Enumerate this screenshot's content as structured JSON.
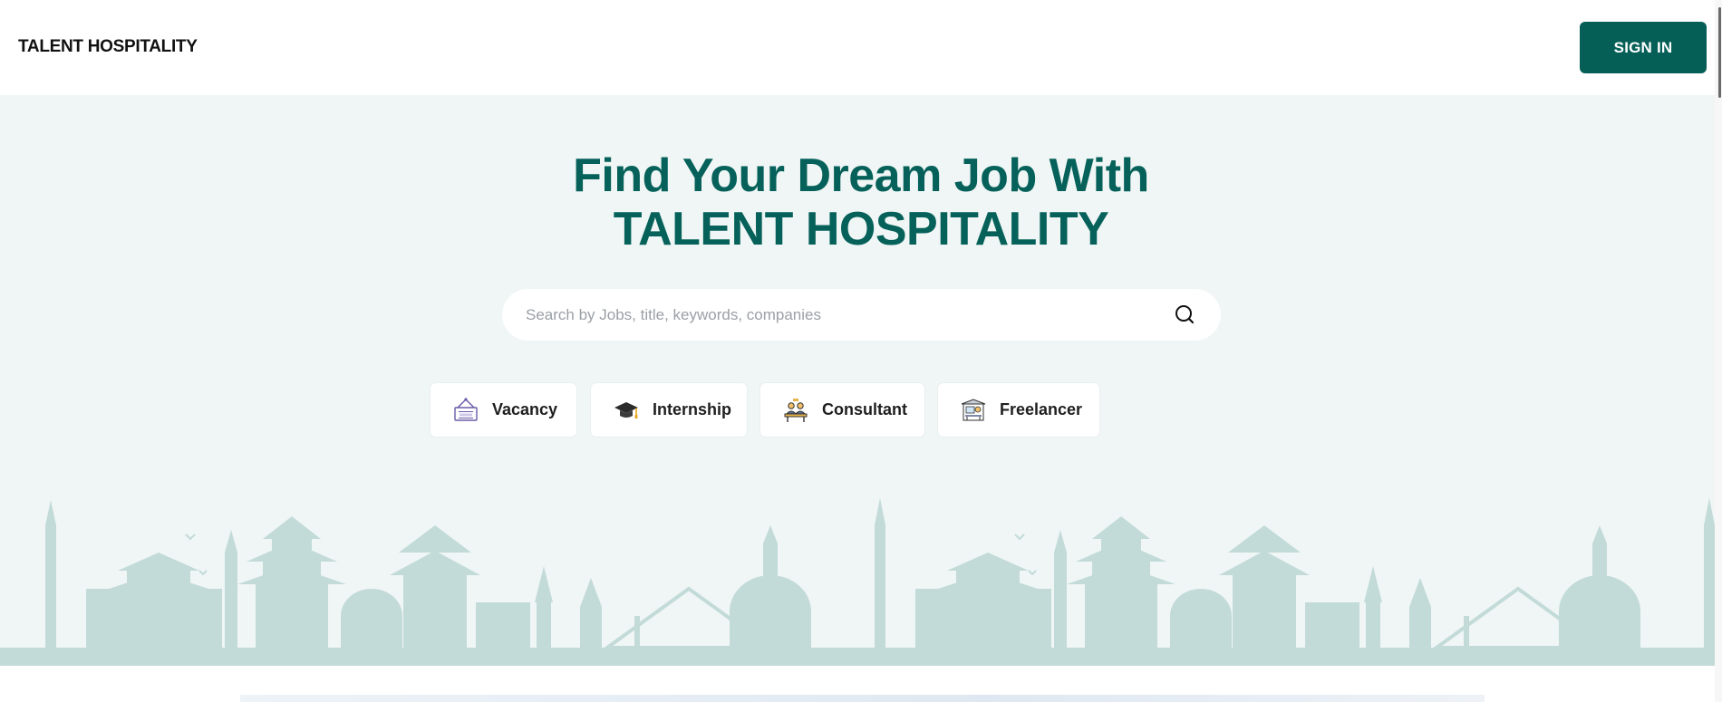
{
  "header": {
    "brand": "TALENT HOSPITALITY",
    "signin_label": "SIGN IN"
  },
  "hero": {
    "title_line1": "Find Your Dream Job With",
    "title_line2": "TALENT HOSPITALITY",
    "search": {
      "placeholder": "Search by Jobs, title, keywords, companies",
      "value": ""
    },
    "categories": [
      {
        "label": "Vacancy",
        "icon": "vacancy-board-icon"
      },
      {
        "label": "Internship",
        "icon": "graduation-cap-icon"
      },
      {
        "label": "Consultant",
        "icon": "consultant-desk-icon"
      },
      {
        "label": "Freelancer",
        "icon": "freelancer-workspace-icon"
      }
    ]
  },
  "colors": {
    "brand_green": "#065f57",
    "hero_bg": "#eff6f5",
    "skyline": "#c3dbd8"
  }
}
